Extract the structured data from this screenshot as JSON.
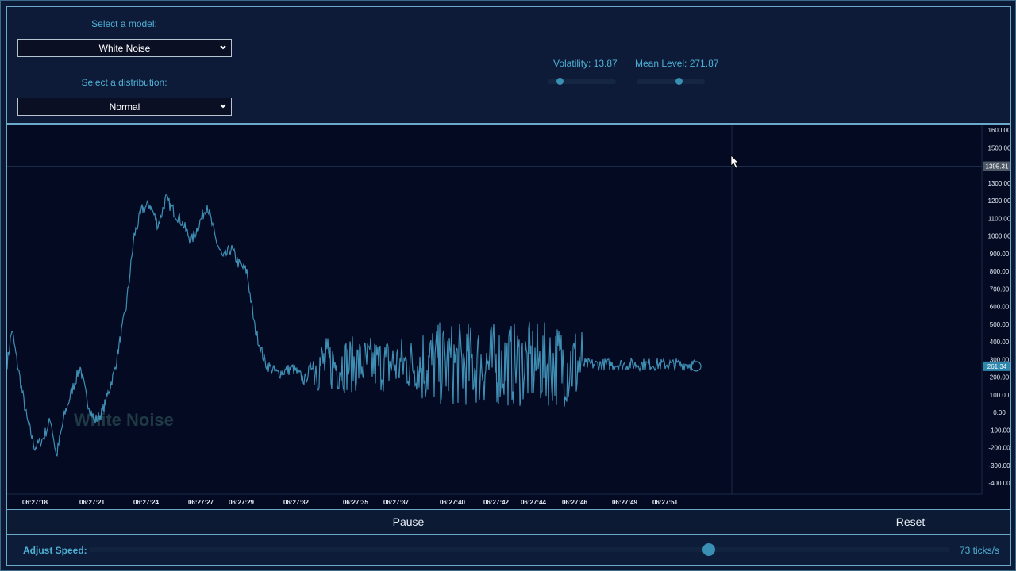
{
  "controls": {
    "model_label": "Select a model:",
    "model_value": "White Noise",
    "distribution_label": "Select a distribution:",
    "distribution_value": "Normal"
  },
  "params": {
    "volatility_label": "Volatility: 13.87",
    "volatility_level": 0.18,
    "mean_label": "Mean Level: 271.87",
    "mean_level": 0.62
  },
  "chart": {
    "watermark": "White Noise",
    "y_ticks": [
      "1600.00",
      "1500.00",
      "1400.00",
      "1300.00",
      "1200.00",
      "1100.00",
      "1000.00",
      "900.00",
      "800.00",
      "700.00",
      "600.00",
      "500.00",
      "400.00",
      "300.00",
      "200.00",
      "100.00",
      "0.00",
      "-100.00",
      "-200.00",
      "-300.00",
      "-400.00"
    ],
    "crosshair_price": "1395.31",
    "last_price": "261.34",
    "x_ticks": [
      "06:27:18",
      "06:27:21",
      "06:27:24",
      "06:27:27",
      "06:27:29",
      "06:27:32",
      "06:27:35",
      "06:27:37",
      "06:27:40",
      "06:27:42",
      "06:27:44",
      "06:27:46",
      "06:27:49",
      "06:27:51"
    ],
    "colors": {
      "line": "#3f8fb5",
      "background": "#040a22",
      "axis_text": "#e6eef6"
    }
  },
  "buttons": {
    "pause": "Pause",
    "reset": "Reset"
  },
  "speed": {
    "label": "Adjust Speed:",
    "value": "73 ticks/s",
    "level": 0.72
  }
}
